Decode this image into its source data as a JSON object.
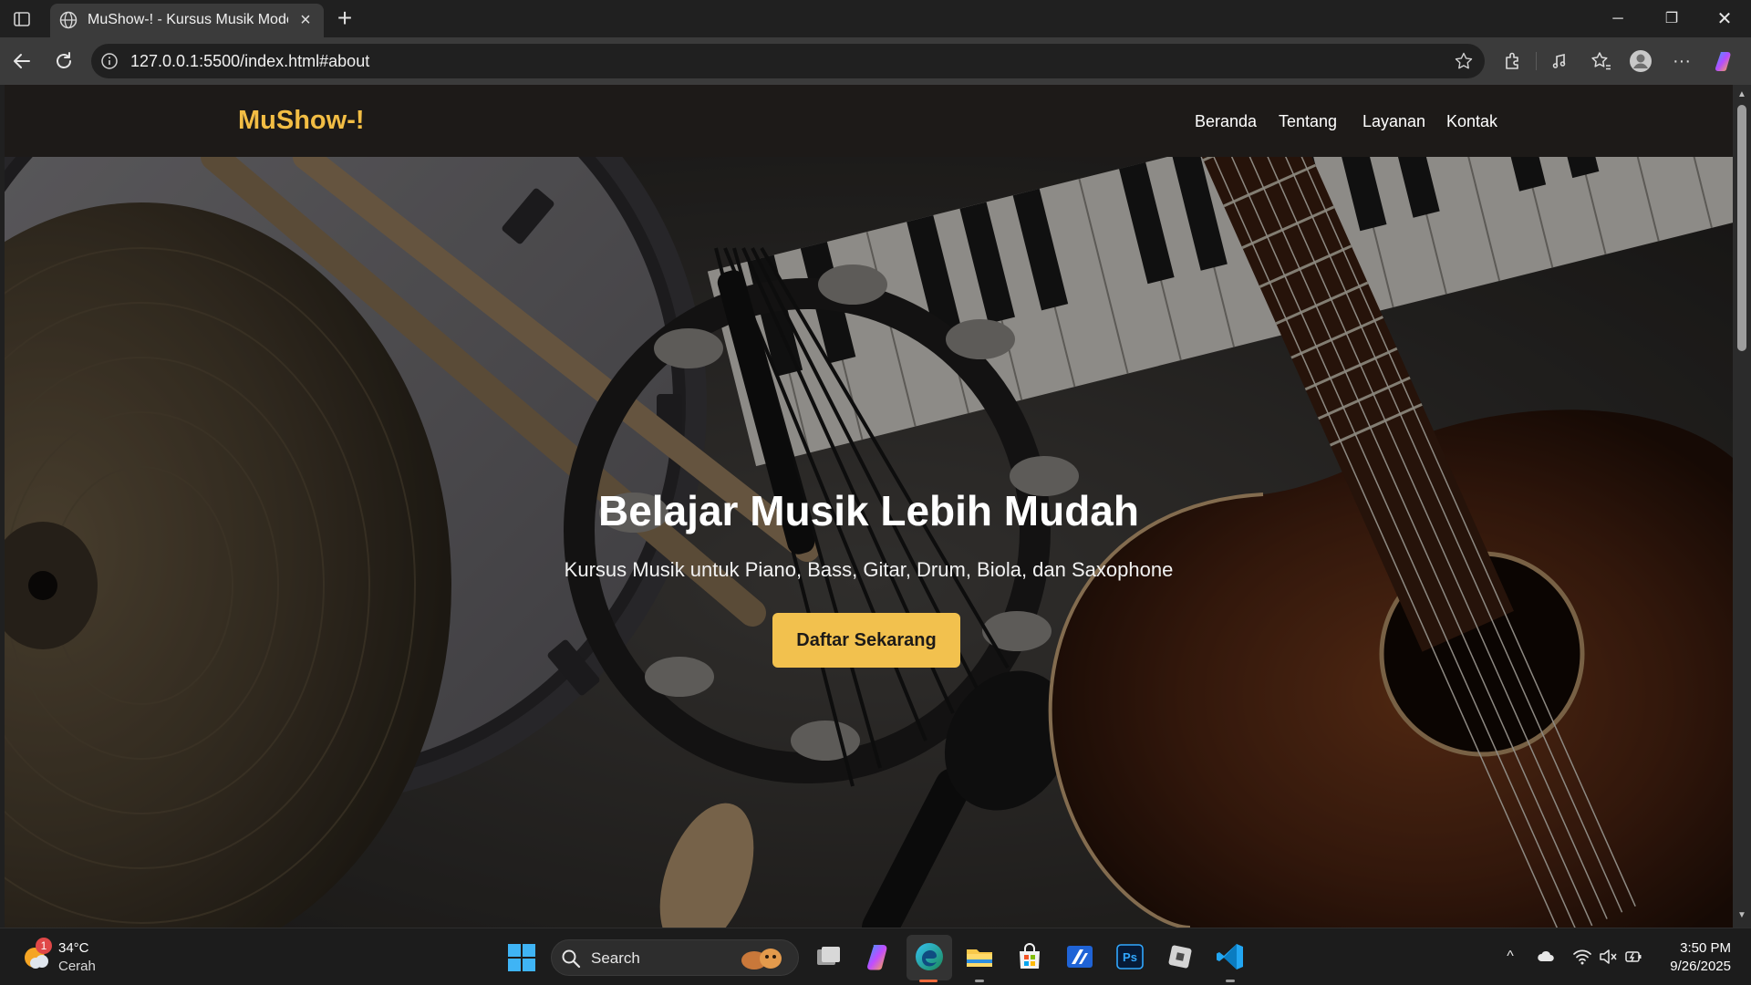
{
  "browser": {
    "tab_title": "MuShow-! - Kursus Musik Modern",
    "url": "127.0.0.1:5500/index.html#about"
  },
  "site": {
    "logo": "MuShow-!",
    "nav": [
      "Beranda",
      "Tentang",
      "Layanan",
      "Kontak"
    ],
    "hero": {
      "title": "Belajar Musik Lebih Mudah",
      "subtitle": "Kursus Musik untuk Piano, Bass, Gitar, Drum, Biola, dan Saxophone",
      "cta": "Daftar Sekarang"
    },
    "colors": {
      "accent": "#f2c14e",
      "nav_bg": "#1d1a18",
      "logo": "#f2bd44"
    }
  },
  "taskbar": {
    "weather": {
      "badge": "1",
      "temp": "34°C",
      "condition": "Cerah"
    },
    "search_label": "Search",
    "apps": [
      "task-view",
      "copilot",
      "edge",
      "file-explorer",
      "microsoft-store",
      "app-blue",
      "photoshop",
      "app-grey",
      "vscode"
    ],
    "clock": {
      "time": "3:50 PM",
      "date": "9/26/2025"
    }
  }
}
